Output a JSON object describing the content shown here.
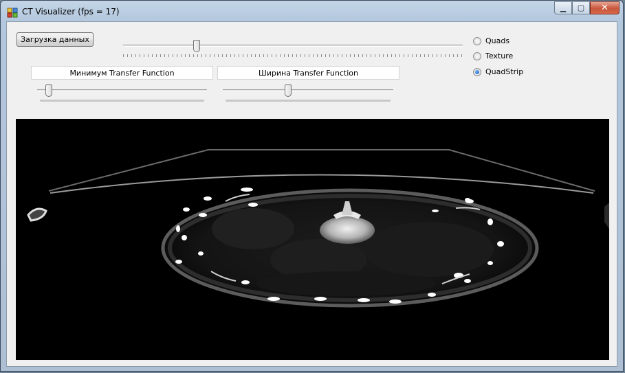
{
  "window": {
    "title": "CT Visualizer (fps = 17)"
  },
  "caption_buttons": {
    "minimize": "▁",
    "maximize": "▢",
    "close": "✕"
  },
  "controls": {
    "load_button_label": "Загрузка данных",
    "layer_slider_value": 0.21,
    "tf_min_label": "Минимум Transfer Function",
    "tf_min_value": 0.05,
    "tf_width_label": "Ширина Transfer Function",
    "tf_width_value": 0.38
  },
  "render_mode": {
    "options": [
      "Quads",
      "Texture",
      "QuadStrip"
    ],
    "selected": "QuadStrip"
  },
  "colors": {
    "viewport_bg": "#000000",
    "radio_checked": "#1656b5"
  }
}
